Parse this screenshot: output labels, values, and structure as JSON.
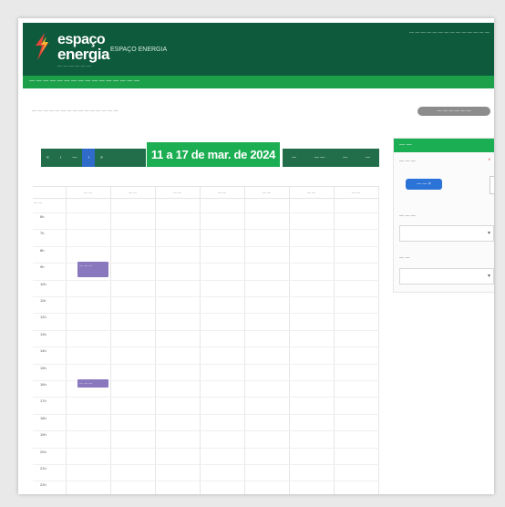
{
  "header": {
    "logo_line1": "espaço",
    "logo_line2": "energia",
    "logo_tagline": "— — — — — —",
    "app_name": "ESPAÇO ENERGIA",
    "user_info": "— — — — — — — — — — — — — —"
  },
  "subnav": {
    "text": "— — — — — — — — — — — — — — — —"
  },
  "breadcrumb": {
    "text": "— — — — — — — — — — — — — — —"
  },
  "top_action": {
    "label": "— — — — — —"
  },
  "toolbar": {
    "left_buttons": [
      "«",
      "‹",
      "—",
      "›",
      "»"
    ],
    "active_index": 3,
    "date_range": "11 a 17 de mar. de 2024",
    "right_buttons": [
      "—",
      "— —",
      "—",
      "—"
    ]
  },
  "calendar": {
    "allday_label": "— —",
    "day_headers": [
      "— —",
      "— —",
      "— —",
      "— —",
      "— —",
      "— —",
      "— —"
    ],
    "times": [
      "6h",
      "7h",
      "8h",
      "9h",
      "10h",
      "11h",
      "12h",
      "13h",
      "14h",
      "15h",
      "16h",
      "17h",
      "18h",
      "19h",
      "20h",
      "21h",
      "22h"
    ],
    "events": [
      {
        "label": "— — —",
        "row": 3,
        "col": 0,
        "span": 2
      },
      {
        "label": "— — —",
        "row": 10,
        "col": 0,
        "span": 1
      }
    ]
  },
  "sidebar": {
    "title": "— —",
    "field1_label": "— — —",
    "required_mark": "*",
    "chip_label": "— — ×",
    "field2_label": "— — —",
    "field3_label": "— —",
    "dropdown_chevron": "▾"
  },
  "colors": {
    "header_bg": "#0e5a3d",
    "accent_green": "#1cae52",
    "toolbar_dark": "#226e4a",
    "active_blue": "#2f6bc9",
    "event_purple": "#8a78bf"
  }
}
